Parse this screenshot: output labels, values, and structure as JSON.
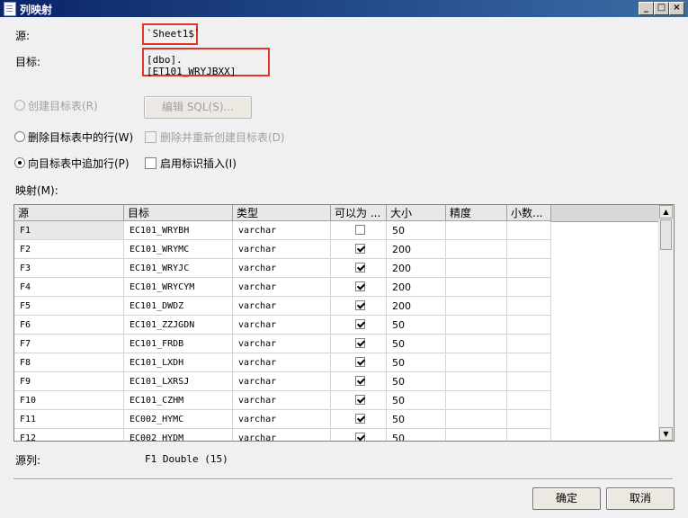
{
  "window": {
    "title": "列映射",
    "minimize": "_",
    "maximize": "□",
    "close": "×"
  },
  "source": {
    "label": "源:",
    "value": "`Sheet1$`"
  },
  "target": {
    "label": "目标:",
    "value": "[dbo].[ET101_WRYJBXX]"
  },
  "options": {
    "create_table": "创建目标表(R)",
    "edit_sql": "编辑 SQL(S)...",
    "delete_rows": "删除目标表中的行(W)",
    "drop_recreate": "删除并重新创建目标表(D)",
    "append_rows": "向目标表中追加行(P)",
    "identity_insert": "启用标识插入(I)"
  },
  "mapping_label": "映射(M):",
  "grid": {
    "columns": [
      "源",
      "目标",
      "类型",
      "可以为 ...",
      "大小",
      "精度",
      "小数..."
    ],
    "rows": [
      {
        "src": "F1",
        "dst": "EC101_WRYBH",
        "type": "varchar",
        "nullable": false,
        "size": "50",
        "prec": "",
        "scale": ""
      },
      {
        "src": "F2",
        "dst": "EC101_WRYMC",
        "type": "varchar",
        "nullable": true,
        "size": "200",
        "prec": "",
        "scale": ""
      },
      {
        "src": "F3",
        "dst": "EC101_WRYJC",
        "type": "varchar",
        "nullable": true,
        "size": "200",
        "prec": "",
        "scale": ""
      },
      {
        "src": "F4",
        "dst": "EC101_WRYCYM",
        "type": "varchar",
        "nullable": true,
        "size": "200",
        "prec": "",
        "scale": ""
      },
      {
        "src": "F5",
        "dst": "EC101_DWDZ",
        "type": "varchar",
        "nullable": true,
        "size": "200",
        "prec": "",
        "scale": ""
      },
      {
        "src": "F6",
        "dst": "EC101_ZZJGDN",
        "type": "varchar",
        "nullable": true,
        "size": "50",
        "prec": "",
        "scale": ""
      },
      {
        "src": "F7",
        "dst": "EC101_FRDB",
        "type": "varchar",
        "nullable": true,
        "size": "50",
        "prec": "",
        "scale": ""
      },
      {
        "src": "F8",
        "dst": "EC101_LXDH",
        "type": "varchar",
        "nullable": true,
        "size": "50",
        "prec": "",
        "scale": ""
      },
      {
        "src": "F9",
        "dst": "EC101_LXRSJ",
        "type": "varchar",
        "nullable": true,
        "size": "50",
        "prec": "",
        "scale": ""
      },
      {
        "src": "F10",
        "dst": "EC101_CZHM",
        "type": "varchar",
        "nullable": true,
        "size": "50",
        "prec": "",
        "scale": ""
      },
      {
        "src": "F11",
        "dst": "EC002_HYMC",
        "type": "varchar",
        "nullable": true,
        "size": "50",
        "prec": "",
        "scale": ""
      },
      {
        "src": "F12",
        "dst": "EC002_HYDM",
        "type": "varchar",
        "nullable": true,
        "size": "50",
        "prec": "",
        "scale": ""
      }
    ]
  },
  "source_column": {
    "label": "源列:",
    "value": "F1 Double (15)"
  },
  "buttons": {
    "ok": "确定",
    "cancel": "取消"
  }
}
